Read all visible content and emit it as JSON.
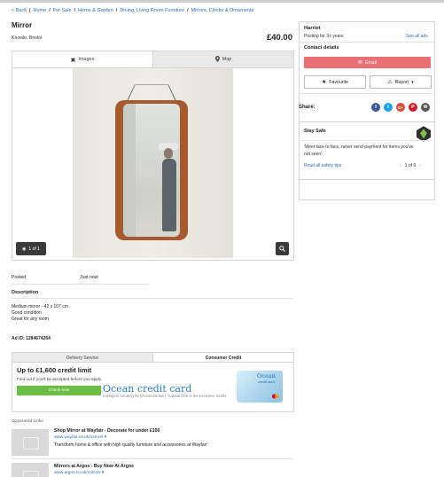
{
  "breadcrumb": {
    "back": "< Back",
    "items": [
      "Home",
      "For Sale",
      "Home & Garden",
      "Dining, Living Room Furniture",
      "Mirrors, Clocks & Ornaments"
    ]
  },
  "listing": {
    "title": "Mirror",
    "location": "Knowle, Bristol",
    "price": "£40.00"
  },
  "gallery": {
    "tabs": [
      {
        "label": "Images",
        "icon": "camera-icon",
        "active": true
      },
      {
        "label": "Map",
        "icon": "map-pin-icon",
        "active": false
      }
    ],
    "counter": "1 of 1",
    "zoom_icon": "zoom-icon"
  },
  "seller": {
    "name": "Harriet",
    "since": "Posting for 3+ years",
    "see_all": "See all ads",
    "contact_heading": "Contact details",
    "email_label": "Email",
    "favourite_label": "Favourite",
    "report_label": "Report"
  },
  "share": {
    "label": "Share:",
    "networks": [
      {
        "name": "facebook-icon",
        "glyph": "f",
        "color": "#3b5998"
      },
      {
        "name": "twitter-icon",
        "glyph": "t",
        "color": "#1da1f2"
      },
      {
        "name": "google-plus-icon",
        "glyph": "G+",
        "color": "#dd4b39"
      },
      {
        "name": "pinterest-icon",
        "glyph": "P",
        "color": "#cb2027"
      },
      {
        "name": "email-share-icon",
        "glyph": "✉",
        "color": "#555555"
      }
    ]
  },
  "safety": {
    "heading": "Stay Safe",
    "quote": "'Meet face to face, never send payment for items you've not seen'",
    "link": "Read all safety tips",
    "pager": "1 of 9"
  },
  "details": {
    "posted_label": "Posted",
    "posted_value": "Just now",
    "description_heading": "Description",
    "description_lines": [
      "Medium mirror - 42 x 107 cm",
      "Good condition",
      "Great for any room"
    ],
    "ad_id": "Ad ID: 1284674264"
  },
  "credit": {
    "tabs": [
      "Delivery Service",
      "Consumer Credit"
    ],
    "heading": "Up to £1,600 credit limit",
    "subtext": "Find out if you'll be accepted before you apply.",
    "button": "Check now",
    "brand": "Ocean credit card",
    "fine_print": "Intelligent Lending ltd (Ocean Broker). Capital One is the exclusive lender.",
    "card_title": "Ocean",
    "card_sub": "credit card"
  },
  "sponsored": {
    "label": "Sponsored Links",
    "ads": [
      {
        "title": "Shop Mirror at Wayfair - Decorate for under £100",
        "url": "www.wayfair.co.uk/mirrors",
        "desc": "Transform home & office with high quality furniture and accessories at Wayfair"
      },
      {
        "title": "Mirrors at Argos - Buy Now At Argos",
        "url": "www.argos.co.uk/mirrors",
        "desc": ""
      }
    ]
  }
}
